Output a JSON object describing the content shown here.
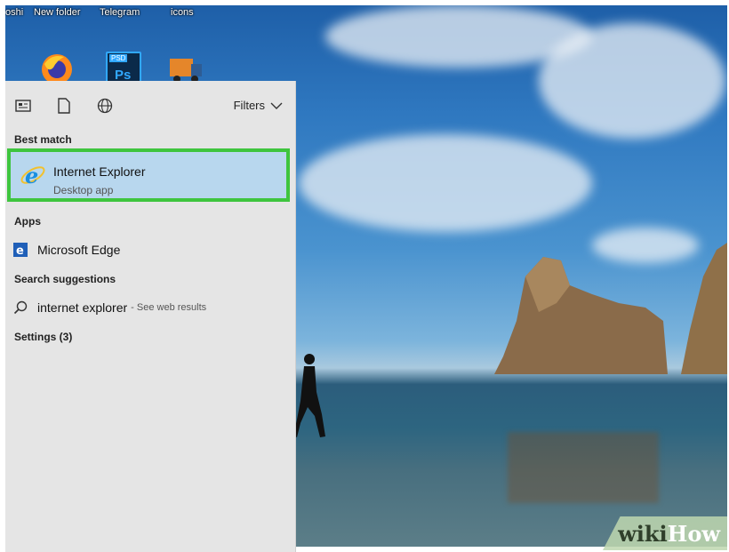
{
  "desktop": {
    "labels": [
      "oshi",
      "New folder",
      "Telegram",
      "icons"
    ],
    "icons": [
      "firefox-icon",
      "photoshop-icon",
      "truck-app-icon"
    ],
    "photoshop_badge": "PSD",
    "photoshop_text": "Ps"
  },
  "search_panel": {
    "toolbar": {
      "icons": [
        "apps-filter-icon",
        "documents-filter-icon",
        "web-filter-icon"
      ],
      "filters_label": "Filters"
    },
    "best_match": {
      "heading": "Best match",
      "title": "Internet Explorer",
      "subtitle": "Desktop app",
      "icon": "internet-explorer-icon",
      "highlight_color": "#3ec53e"
    },
    "apps": {
      "heading": "Apps",
      "items": [
        {
          "label": "Microsoft Edge",
          "icon": "microsoft-edge-icon"
        }
      ]
    },
    "suggestions": {
      "heading": "Search suggestions",
      "items": [
        {
          "query": "internet explorer",
          "hint": "- See web results",
          "icon": "search-icon"
        }
      ]
    },
    "settings": {
      "heading": "Settings (3)"
    }
  },
  "watermark": {
    "part1": "wiki",
    "part2": "How"
  }
}
